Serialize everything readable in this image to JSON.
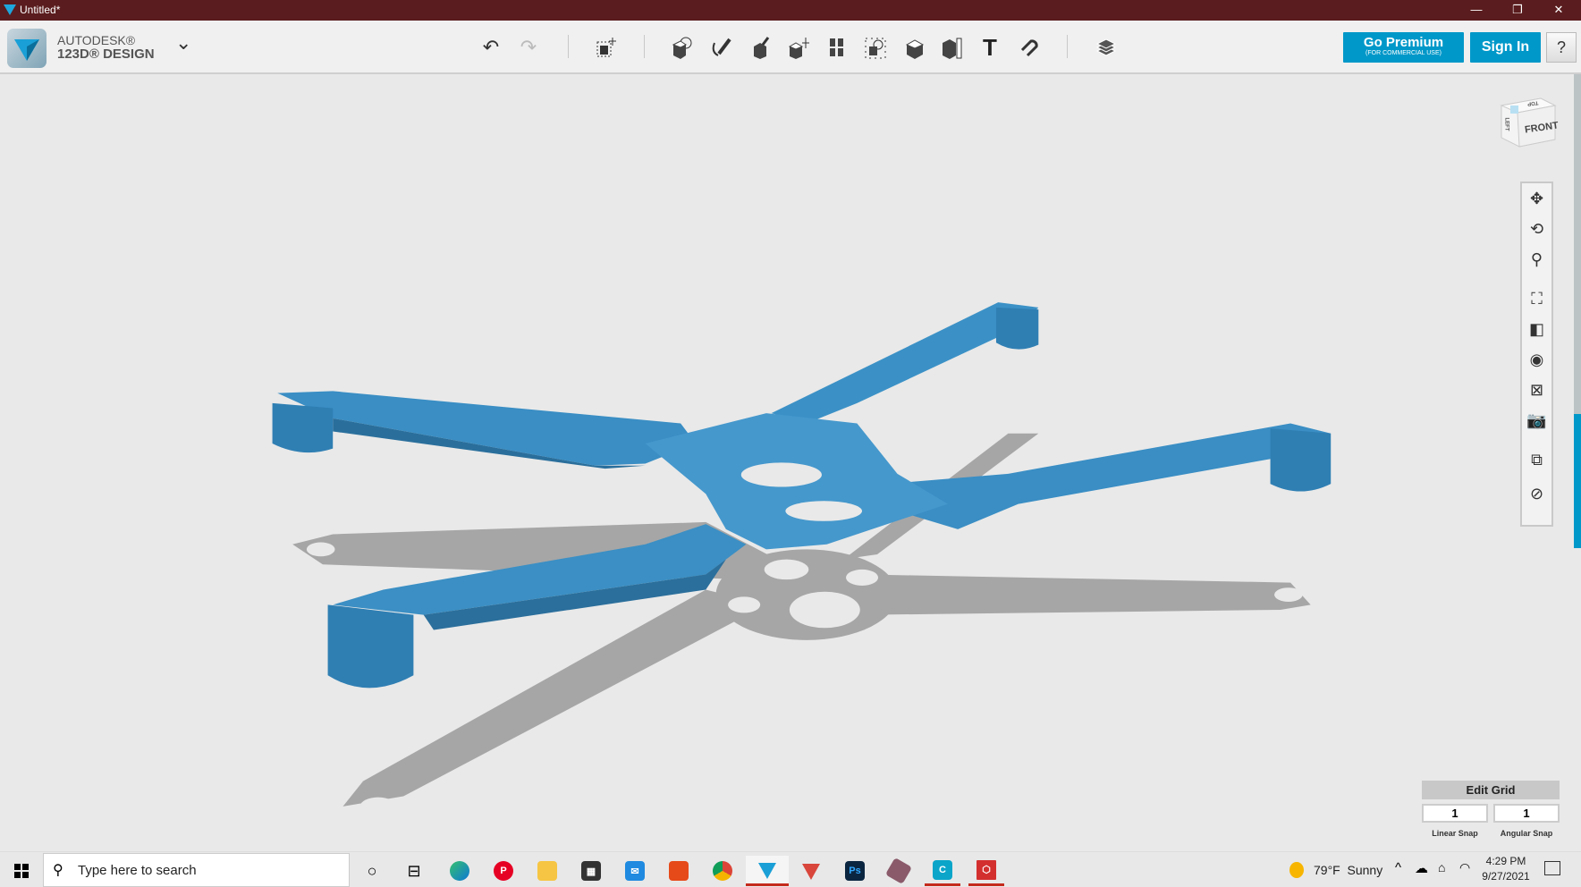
{
  "window": {
    "title": "Untitled*",
    "minimize": "—",
    "restore": "❐",
    "close": "✕"
  },
  "app": {
    "brand_top": "AUTODESK®",
    "brand_bottom": "123D® DESIGN",
    "menu_chevron": "⌄"
  },
  "toolbar": {
    "tools": [
      {
        "icon": "undo-icon"
      },
      {
        "icon": "redo-icon"
      },
      {
        "icon": "transform-icon"
      },
      {
        "icon": "primitives-icon"
      },
      {
        "icon": "sketch-icon"
      },
      {
        "icon": "construct-icon"
      },
      {
        "icon": "modify-icon"
      },
      {
        "icon": "pattern-icon"
      },
      {
        "icon": "grouping-icon"
      },
      {
        "icon": "combine-icon"
      },
      {
        "icon": "measure-icon"
      },
      {
        "icon": "text-icon"
      },
      {
        "icon": "snap-icon"
      },
      {
        "icon": "material-icon"
      }
    ],
    "go_premium": "Go Premium",
    "go_premium_sub": "(FOR COMMERCIAL USE)",
    "sign_in": "Sign In",
    "help": "?"
  },
  "viewcube": {
    "front": "FRONT",
    "left": "LEFT",
    "top": "TOP"
  },
  "navbar": [
    "pan-icon",
    "orbit-icon",
    "zoom-icon",
    "fit-icon",
    "view-mode-icon",
    "visibility-icon",
    "grid-toggle-icon",
    "screenshot-icon",
    "snap-materials-icon",
    "hide-sketch-icon"
  ],
  "grid": {
    "title": "Edit Grid",
    "linear_value": "1",
    "angular_value": "1",
    "linear_label": "Linear Snap",
    "angular_label": "Angular Snap"
  },
  "model": {
    "color": "#3b8fc4",
    "shadow": "#a9a9a9"
  },
  "taskbar": {
    "search_placeholder": "Type here to search",
    "weather": "79°F  Sunny",
    "time": "4:29 PM",
    "date": "9/27/2021",
    "apps": [
      "edge",
      "pinterest",
      "file-explorer",
      "store",
      "mail",
      "office",
      "chrome",
      "123d-design",
      "vectary",
      "photoshop",
      "meshmixer",
      "cura",
      "fusion"
    ]
  }
}
